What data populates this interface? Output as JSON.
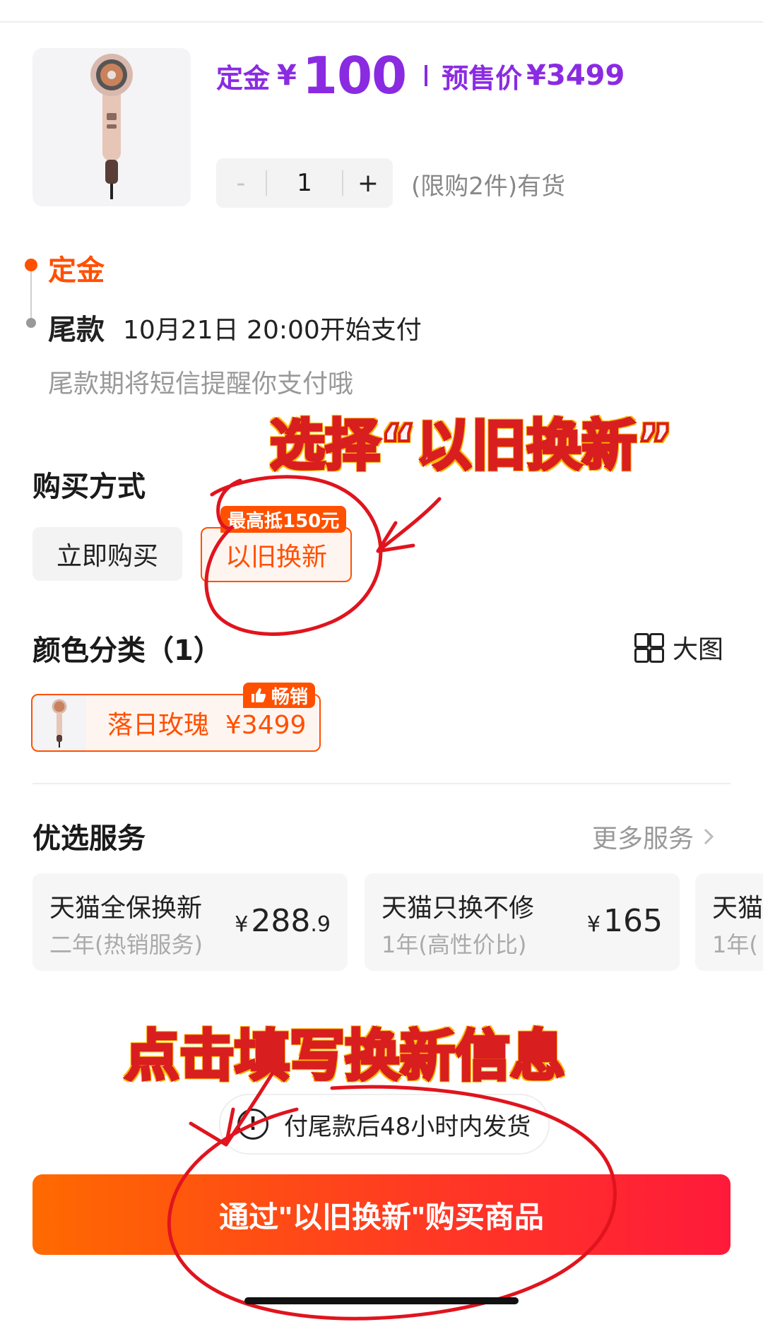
{
  "product": {
    "deposit_label": "定金",
    "currency": "¥",
    "deposit_amount": "100",
    "presale_label": "预售价",
    "presale_price": "¥3499"
  },
  "quantity": {
    "minus": "-",
    "value": "1",
    "plus": "+",
    "stock_text": "(限购2件)有货"
  },
  "timeline": {
    "step1": "定金",
    "step2_label": "尾款",
    "step2_time": "10月21日 20:00开始支付",
    "reminder": "尾款期将短信提醒你支付哦"
  },
  "annotations": {
    "top": "选择“以旧换新”",
    "bottom": "点击填写换新信息"
  },
  "purchase_method": {
    "title": "购买方式",
    "options": [
      "立即购买",
      "以旧换新"
    ],
    "badge": "最高抵150元",
    "selected": "以旧换新"
  },
  "color": {
    "title": "颜色分类（1）",
    "big_image_label": "大图",
    "option_label": "落日玫瑰",
    "option_price": "¥3499",
    "hot_badge": "畅销"
  },
  "services": {
    "title": "优选服务",
    "more": "更多服务",
    "items": [
      {
        "name": "天猫全保换新",
        "sub": "二年(热销服务)",
        "currency": "¥",
        "price_int": "288",
        "price_dec": ".9"
      },
      {
        "name": "天猫只换不修",
        "sub": "1年(高性价比)",
        "currency": "¥",
        "price_int": "165",
        "price_dec": ""
      },
      {
        "name": "天猫",
        "sub": "1年("
      }
    ]
  },
  "notice": {
    "icon": "!",
    "text": "付尾款后48小时内发货"
  },
  "cta": {
    "label": "通过\"以旧换新\"购买商品"
  },
  "colors": {
    "accent": "#ff5000",
    "price_purple": "#8a2be2",
    "annotation_red": "#d81e1e"
  }
}
